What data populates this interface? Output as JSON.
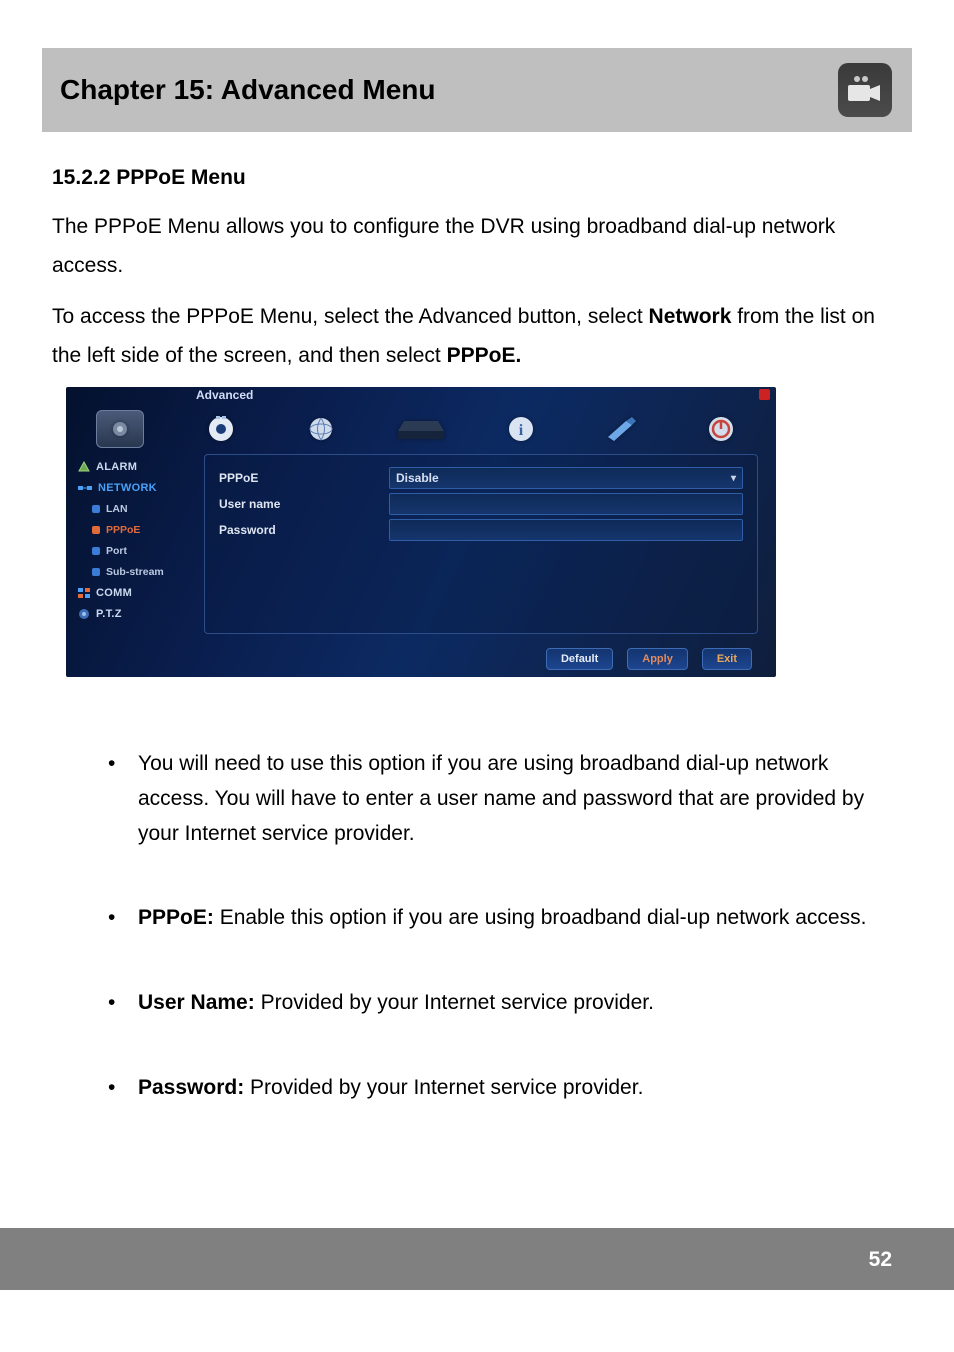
{
  "chapter": {
    "title": "Chapter 15: Advanced Menu"
  },
  "section": {
    "heading": "15.2.2 PPPoE Menu"
  },
  "paragraphs": {
    "intro": "The PPPoE Menu allows you to configure the DVR using broadband dial-up network access.",
    "access_pre": "To access the PPPoE Menu, select the Advanced button, select ",
    "access_bold1": "Network",
    "access_mid": " from the list on the left side of the screen, and then select ",
    "access_bold2": "PPPoE."
  },
  "dvr": {
    "window_title": "Advanced",
    "sidebar": {
      "alarm": "ALARM",
      "network": "NETWORK",
      "lan": "LAN",
      "pppoe": "PPPoE",
      "port": "Port",
      "substream": "Sub-stream",
      "comm": "COMM",
      "ptz": "P.T.Z"
    },
    "form": {
      "pppoe_label": "PPPoE",
      "pppoe_value": "Disable",
      "username_label": "User name",
      "username_value": "",
      "password_label": "Password",
      "password_value": ""
    },
    "buttons": {
      "default": "Default",
      "apply": "Apply",
      "exit": "Exit"
    }
  },
  "bullets": {
    "b1": "You will need to use this option if you are using broadband dial-up network access. You will have to enter a user name and password that are provided by your Internet service provider.",
    "b2_label": "PPPoE:",
    "b2_text": " Enable this option if you are using broadband dial-up network access.",
    "b3_label": "User Name:",
    "b3_text": " Provided by your Internet service provider.",
    "b4_label": "Password:",
    "b4_text": " Provided by your Internet service provider."
  },
  "page_number": "52"
}
